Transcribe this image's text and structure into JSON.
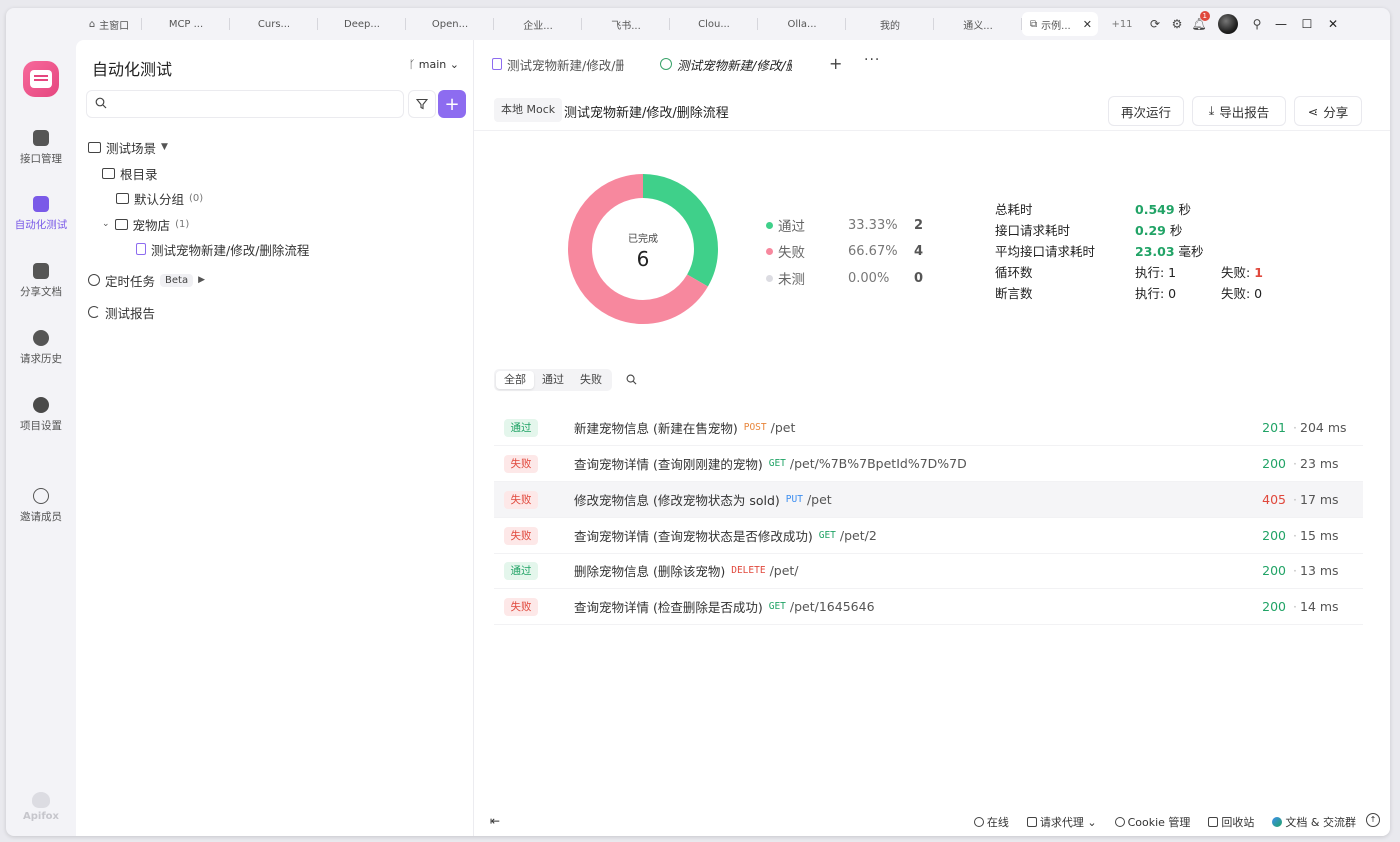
{
  "browser_tabs": [
    "主窗口",
    "MCP ...",
    "Curs...",
    "Deep...",
    "Open...",
    "企业...",
    "飞书...",
    "Clou...",
    "Olla...",
    "我的",
    "通义...",
    "示例..."
  ],
  "browser_more": "+11",
  "notification_count": "1",
  "rail": {
    "items": [
      "接口管理",
      "自动化测试",
      "分享文档",
      "请求历史",
      "项目设置",
      "邀请成员"
    ],
    "footer": "Apifox"
  },
  "sidebar": {
    "title": "自动化测试",
    "branch": "main",
    "search_placeholder": "",
    "tree": {
      "scenarios": "测试场景",
      "root": "根目录",
      "default_group": "默认分组",
      "default_group_count": "(0)",
      "pet_store": "宠物店",
      "pet_store_count": "(1)",
      "flow": "测试宠物新建/修改/删除流程",
      "scheduled": "定时任务",
      "beta": "Beta",
      "reports": "测试报告"
    }
  },
  "main": {
    "tabs": [
      "测试宠物新建/修改/删除流程",
      "测试宠物新建/修改/删除流程"
    ],
    "env": "本地 Mock",
    "run_name": "测试宠物新建/修改/删除流程",
    "actions": {
      "rerun": "再次运行",
      "export": "导出报告",
      "share": "分享"
    },
    "donut": {
      "label": "已完成",
      "total": "6"
    },
    "legend": [
      {
        "name": "通过",
        "pct": "33.33%",
        "count": "2",
        "color": "#3fd08a"
      },
      {
        "name": "失败",
        "pct": "66.67%",
        "count": "4",
        "color": "#f7889e"
      },
      {
        "name": "未测",
        "pct": "0.00%",
        "count": "0",
        "color": "#dcdce2"
      }
    ],
    "stats": {
      "total_time_label": "总耗时",
      "total_time_value": "0.549",
      "total_time_unit": " 秒",
      "req_time_label": "接口请求耗时",
      "req_time_value": "0.29",
      "req_time_unit": " 秒",
      "avg_time_label": "平均接口请求耗时",
      "avg_time_value": "23.03",
      "avg_time_unit": " 毫秒",
      "loops_label": "循环数",
      "loops_exec": "执行: 1",
      "loops_fail_prefix": "失败: ",
      "loops_fail": "1",
      "asserts_label": "断言数",
      "asserts_exec": "执行: 0",
      "asserts_fail": "失败: 0"
    },
    "filters": [
      "全部",
      "通过",
      "失败"
    ],
    "results": [
      {
        "status": "通过",
        "name": "新建宠物信息 (新建在售宠物)",
        "method": "POST",
        "path": "/pet",
        "code": "201",
        "time": "204 ms"
      },
      {
        "status": "失败",
        "name": "查询宠物详情 (查询刚刚建的宠物)",
        "method": "GET",
        "path": "/pet/%7B%7BpetId%7D%7D",
        "code": "200",
        "time": "23 ms"
      },
      {
        "status": "失败",
        "name": "修改宠物信息 (修改宠物状态为 sold)",
        "method": "PUT",
        "path": "/pet",
        "code": "405",
        "time": "17 ms"
      },
      {
        "status": "失败",
        "name": "查询宠物详情 (查询宠物状态是否修改成功)",
        "method": "GET",
        "path": "/pet/2",
        "code": "200",
        "time": "15 ms"
      },
      {
        "status": "通过",
        "name": "删除宠物信息 (删除该宠物)",
        "method": "DELETE",
        "path": "/pet/",
        "code": "200",
        "time": "13 ms"
      },
      {
        "status": "失败",
        "name": "查询宠物详情 (检查删除是否成功)",
        "method": "GET",
        "path": "/pet/1645646",
        "code": "200",
        "time": "14 ms"
      }
    ]
  },
  "statusbar": {
    "online": "在线",
    "proxy": "请求代理",
    "cookie": "Cookie 管理",
    "trash": "回收站",
    "docs": "文档 & 交流群"
  }
}
